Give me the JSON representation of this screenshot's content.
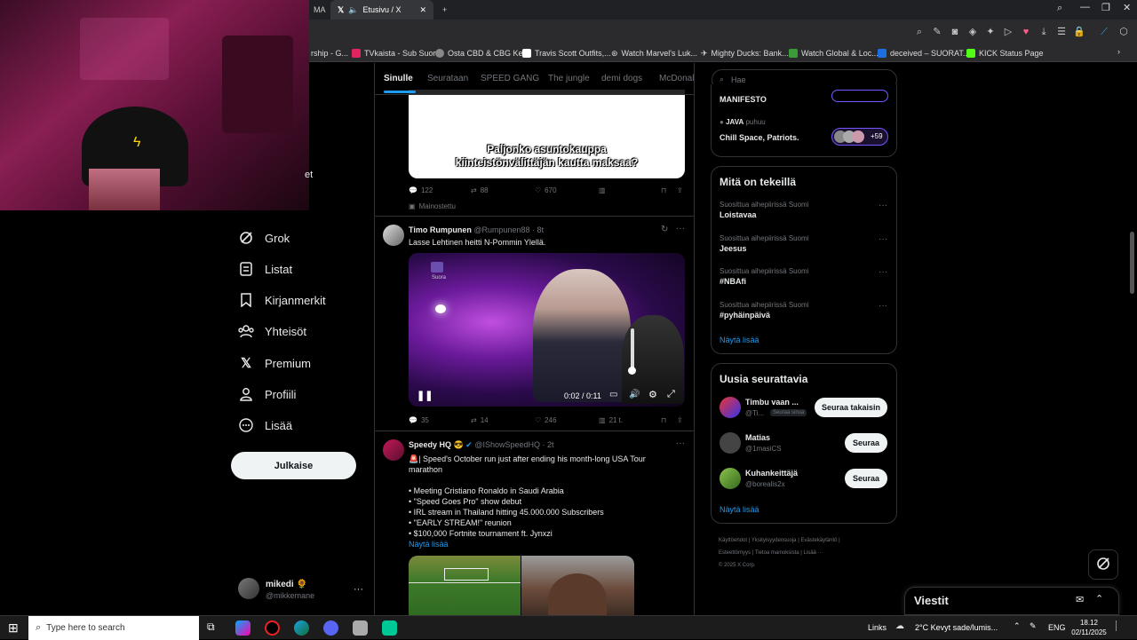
{
  "browser": {
    "tab_partial": "MA",
    "tab_title": "Etusivu / X",
    "bookmarks": [
      {
        "label": "rship - G...",
        "color": "#555"
      },
      {
        "label": "TVkaista - Sub Suora",
        "color": "#e0245e"
      },
      {
        "label": "Osta CBD & CBG Ke...",
        "color": "#888"
      },
      {
        "label": "Travis Scott Outfits,...",
        "color": "#fff"
      },
      {
        "label": "Watch Marvel's Luk...",
        "color": "#aaa"
      },
      {
        "label": "Mighty Ducks: Bank...",
        "color": "#aaa"
      },
      {
        "label": "Watch Global & Loc...",
        "color": "#3a9b3a"
      },
      {
        "label": "deceived – SUORAT...",
        "color": "#1d6fe0"
      },
      {
        "label": "KICK Status Page",
        "color": "#53fc18"
      }
    ]
  },
  "sidebar": {
    "nav": [
      {
        "label": "Grok",
        "icon": "grok-icon"
      },
      {
        "label": "Listat",
        "icon": "lists-icon"
      },
      {
        "label": "Kirjanmerkit",
        "icon": "bookmark-icon"
      },
      {
        "label": "Yhteisöt",
        "icon": "communities-icon"
      },
      {
        "label": "Premium",
        "icon": "x-logo-icon"
      },
      {
        "label": "Profiili",
        "icon": "profile-icon"
      },
      {
        "label": "Lisää",
        "icon": "more-circle-icon"
      }
    ],
    "partial_top_label": "et",
    "post_button": "Julkaise",
    "user": {
      "name": "mikedi",
      "handle": "@mikkemane"
    }
  },
  "feed": {
    "tabs": [
      "Sinulle",
      "Seurataan",
      "SPEED GANG",
      "The jungle",
      "demi dogs",
      "McDonald"
    ],
    "ad": {
      "caption_line1": "Paljonko asuntokauppa",
      "caption_line2": "kiinteistönvälittäjän kautta maksaa?",
      "replies": "122",
      "reposts": "88",
      "likes": "670",
      "promoted": "Mainostettu"
    },
    "post1": {
      "author": "Timo Rumpunen",
      "handle": "@Rumpunen88",
      "time": "· 8t",
      "text": "Lasse Lehtinen heitti N-Pommin Ylellä.",
      "video_time": "0:02 / 0:11",
      "video_watermark": "Suora",
      "replies": "35",
      "reposts": "14",
      "likes": "246",
      "views": "21 t."
    },
    "post2": {
      "author": "Speedy HQ",
      "handle": "@IShowSpeedHQ",
      "time": "· 2t",
      "text_line1": "🚨| Speed's October run just after ending his month-long USA Tour",
      "text_line2": "marathon",
      "bullets": [
        "• Meeting Cristiano Ronaldo in Saudi Arabia",
        "• \"Speed Goes Pro\" show debut",
        "• IRL stream in Thailand hitting 45.000.000 Subscribers",
        "• \"EARLY STREAM!\" reunion",
        "• $100,000 Fortnite tournament ft. Jynxzi"
      ],
      "show_more": "Näytä lisää"
    }
  },
  "right": {
    "search_placeholder": "Hae",
    "spaces": [
      {
        "title": "MANIFESTO"
      },
      {
        "host": "JAVA",
        "host_suffix": "puhuu",
        "title": "Chill Space, Patriots.",
        "count": "+59"
      }
    ],
    "trends_title": "Mitä on tekeillä",
    "trends": [
      {
        "context": "Suosittua aihepiirissä Suomi",
        "name": "Loistavaa"
      },
      {
        "context": "Suosittua aihepiirissä Suomi",
        "name": "Jeesus"
      },
      {
        "context": "Suosittua aihepiirissä Suomi",
        "name": "#NBAfi"
      },
      {
        "context": "Suosittua aihepiirissä Suomi",
        "name": "#pyhäinpäivä"
      }
    ],
    "trends_more": "Näytä lisää",
    "who_title": "Uusia seurattavia",
    "who": [
      {
        "name": "Timbu vaan ...",
        "handle": "@Ti...",
        "badge": "Seuraa sinua",
        "button": "Seuraa takaisin"
      },
      {
        "name": "Matias",
        "handle": "@1masiCS",
        "button": "Seuraa"
      },
      {
        "name": "Kuhankeittäjä",
        "handle": "@borealis2x",
        "button": "Seuraa"
      }
    ],
    "who_more": "Näytä lisää",
    "footer": [
      "Käyttöehdot",
      "Yksityisyydensuoja",
      "Evästekäytäntö",
      "Esteettömyys",
      "Tietoa mainoksista",
      "Lisää ···",
      "© 2025 X Corp."
    ]
  },
  "messages": {
    "title": "Viestit"
  },
  "taskbar": {
    "search_placeholder": "Type here to search",
    "links": "Links",
    "weather": "2°C  Kevyt sade/lumis...",
    "lang": "ENG",
    "time": "18.12",
    "date": "02/11/2025"
  }
}
